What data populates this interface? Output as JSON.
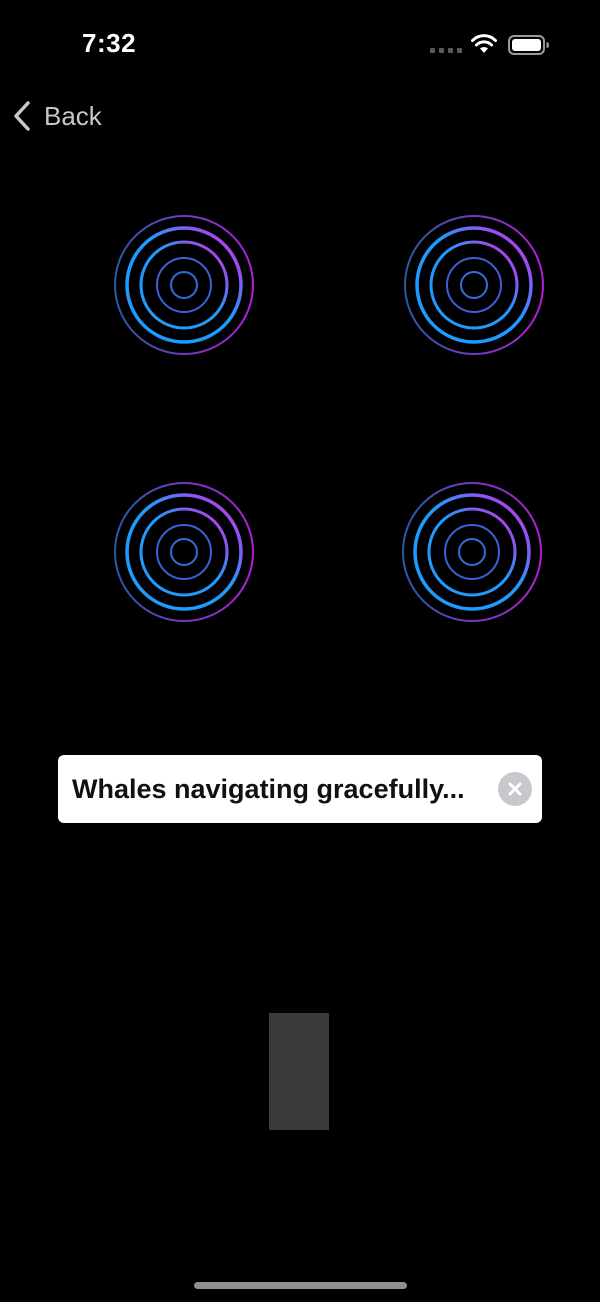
{
  "status_bar": {
    "time": "7:32",
    "icons": [
      "cellular-signal-icon",
      "wifi-icon",
      "battery-icon"
    ]
  },
  "nav": {
    "back_label": "Back",
    "back_icon": "chevron-left-icon"
  },
  "rings": {
    "count": 4,
    "gradient_start": "#1e9bff",
    "gradient_end": "#e61ee6",
    "outer_color": "#2a5aa0"
  },
  "toast": {
    "message": "Whales navigating gracefully...",
    "close_icon": "close-circle-icon"
  },
  "colors": {
    "background": "#000000",
    "block": "#3a393b",
    "home_indicator": "#8e8e93"
  }
}
